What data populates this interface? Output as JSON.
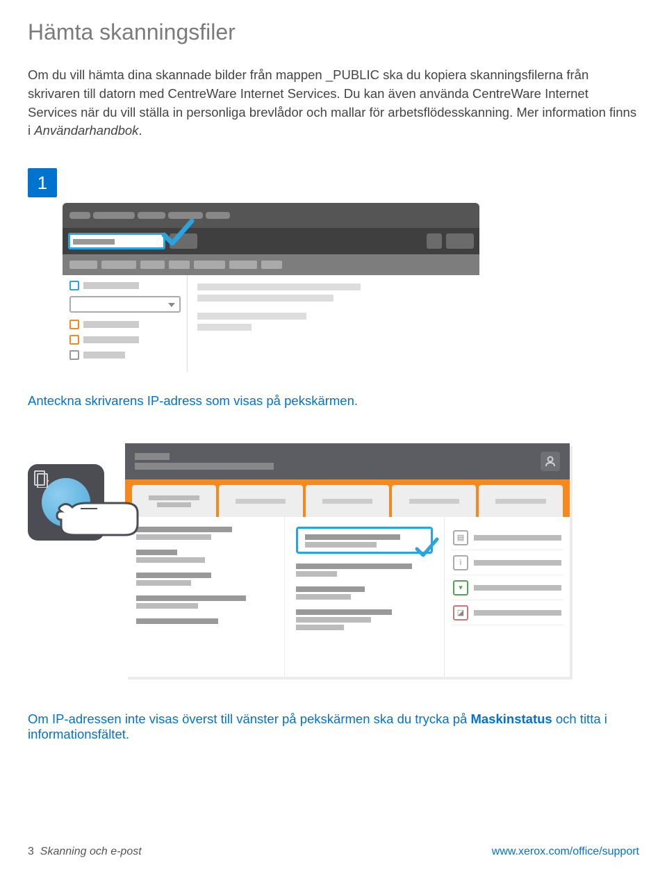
{
  "title": "Hämta skanningsfiler",
  "intro_part1": "Om du vill hämta dina skannade bilder från mappen _PUBLIC ska du kopiera skanningsfilerna från skrivaren till datorn med CentreWare Internet Services. Du kan även använda CentreWare Internet Services när du vill ställa in personliga brevlådor och mallar för arbetsflödesskanning. Mer information finns i ",
  "intro_italic": "Användarhandbok",
  "intro_end": ".",
  "step_number": "1",
  "caption1": "Anteckna skrivarens IP-adress som visas på pekskärmen.",
  "caption2_part1": "Om IP-adressen inte visas överst till vänster på pekskärmen ska du trycka på ",
  "caption2_bold": "Maskinstatus",
  "caption2_part2": " och titta i informationsfältet.",
  "footer_page": "3",
  "footer_section": "Skanning och e-post",
  "footer_link": "www.xerox.com/office/support"
}
